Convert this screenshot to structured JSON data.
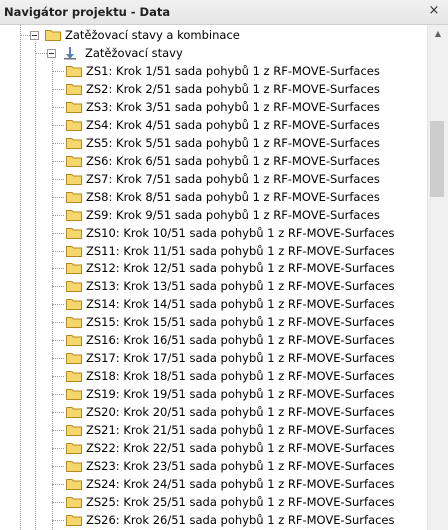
{
  "window": {
    "title": "Navigátor projektu - Data",
    "close_glyph": "×"
  },
  "tree": {
    "root": {
      "label": "Zatěžovací stavy a kombinace",
      "icon": "folder-icon"
    },
    "group": {
      "label": "Zatěžovací stavy",
      "icon": "load-cases-icon"
    },
    "items": [
      {
        "label": "ZS1: Krok 1/51 sada pohybů 1 z RF-MOVE-Surfaces"
      },
      {
        "label": "ZS2: Krok 2/51 sada pohybů 1 z RF-MOVE-Surfaces"
      },
      {
        "label": "ZS3: Krok 3/51 sada pohybů 1 z RF-MOVE-Surfaces"
      },
      {
        "label": "ZS4: Krok 4/51 sada pohybů 1 z RF-MOVE-Surfaces"
      },
      {
        "label": "ZS5: Krok 5/51 sada pohybů 1 z RF-MOVE-Surfaces"
      },
      {
        "label": "ZS6: Krok 6/51 sada pohybů 1 z RF-MOVE-Surfaces"
      },
      {
        "label": "ZS7: Krok 7/51 sada pohybů 1 z RF-MOVE-Surfaces"
      },
      {
        "label": "ZS8: Krok 8/51 sada pohybů 1 z RF-MOVE-Surfaces"
      },
      {
        "label": "ZS9: Krok 9/51 sada pohybů 1 z RF-MOVE-Surfaces"
      },
      {
        "label": "ZS10: Krok 10/51 sada pohybů 1 z RF-MOVE-Surfaces"
      },
      {
        "label": "ZS11: Krok 11/51 sada pohybů 1 z RF-MOVE-Surfaces"
      },
      {
        "label": "ZS12: Krok 12/51 sada pohybů 1 z RF-MOVE-Surfaces"
      },
      {
        "label": "ZS13: Krok 13/51 sada pohybů 1 z RF-MOVE-Surfaces"
      },
      {
        "label": "ZS14: Krok 14/51 sada pohybů 1 z RF-MOVE-Surfaces"
      },
      {
        "label": "ZS15: Krok 15/51 sada pohybů 1 z RF-MOVE-Surfaces"
      },
      {
        "label": "ZS16: Krok 16/51 sada pohybů 1 z RF-MOVE-Surfaces"
      },
      {
        "label": "ZS17: Krok 17/51 sada pohybů 1 z RF-MOVE-Surfaces"
      },
      {
        "label": "ZS18: Krok 18/51 sada pohybů 1 z RF-MOVE-Surfaces"
      },
      {
        "label": "ZS19: Krok 19/51 sada pohybů 1 z RF-MOVE-Surfaces"
      },
      {
        "label": "ZS20: Krok 20/51 sada pohybů 1 z RF-MOVE-Surfaces"
      },
      {
        "label": "ZS21: Krok 21/51 sada pohybů 1 z RF-MOVE-Surfaces"
      },
      {
        "label": "ZS22: Krok 22/51 sada pohybů 1 z RF-MOVE-Surfaces"
      },
      {
        "label": "ZS23: Krok 23/51 sada pohybů 1 z RF-MOVE-Surfaces"
      },
      {
        "label": "ZS24: Krok 24/51 sada pohybů 1 z RF-MOVE-Surfaces"
      },
      {
        "label": "ZS25: Krok 25/51 sada pohybů 1 z RF-MOVE-Surfaces"
      },
      {
        "label": "ZS26: Krok 26/51 sada pohybů 1 z RF-MOVE-Surfaces"
      }
    ]
  },
  "scrollbar": {
    "position": 0.2
  },
  "colors": {
    "folder_fill": "#f5d76e",
    "folder_stroke": "#b48a1e",
    "tree_lines": "#9a9a9a",
    "titlebar": "#e9e9e9"
  }
}
